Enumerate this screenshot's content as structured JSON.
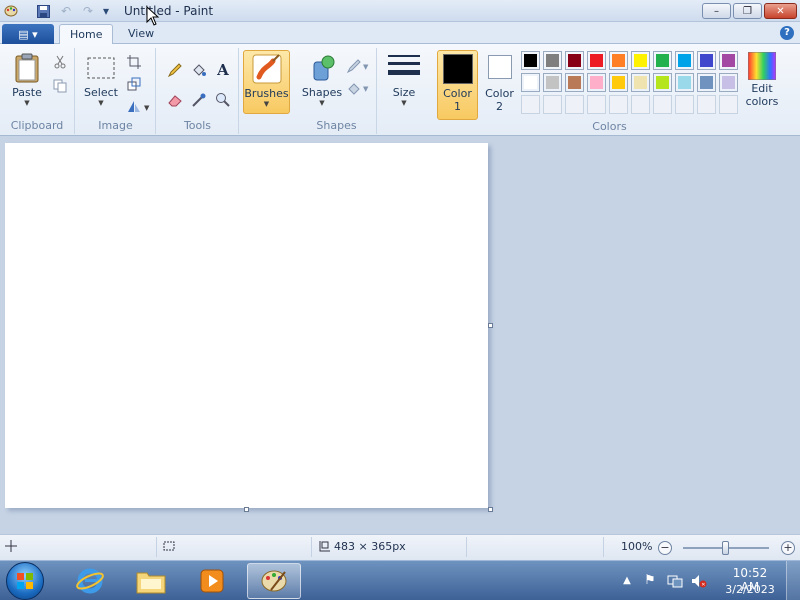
{
  "window": {
    "title": "Untitled - Paint",
    "minimize": "–",
    "maximize": "❐",
    "close": "✕"
  },
  "qat": {
    "app_icon": "paint-palette-icon",
    "save": "save-icon",
    "undo": "undo-icon",
    "redo": "redo-icon",
    "customize": "▾"
  },
  "tabs": {
    "home": "Home",
    "view": "View",
    "help": "?"
  },
  "ribbon": {
    "clipboard": {
      "label": "Clipboard",
      "paste": "Paste"
    },
    "image": {
      "label": "Image",
      "select": "Select"
    },
    "tools": {
      "label": "Tools"
    },
    "brushes": {
      "label": "Brushes"
    },
    "shapes": {
      "label": "Shapes",
      "shapes_btn": "Shapes"
    },
    "size": {
      "label": "Size"
    },
    "colors": {
      "label": "Colors",
      "color1": "Color",
      "color1_num": "1",
      "color2": "Color",
      "color2_num": "2",
      "edit1": "Edit",
      "edit2": "colors",
      "color1_value": "#000000",
      "color2_value": "#ffffff",
      "row1": [
        "#000000",
        "#7f7f7f",
        "#880015",
        "#ed1c24",
        "#ff7f27",
        "#fff200",
        "#22b14c",
        "#00a2e8",
        "#3f48cc",
        "#a349a4"
      ],
      "row2": [
        "#ffffff",
        "#c3c3c3",
        "#b97a57",
        "#ffaec9",
        "#ffc90e",
        "#efe4b0",
        "#b5e61d",
        "#99d9ea",
        "#7092be",
        "#c8bfe7"
      ]
    }
  },
  "status": {
    "canvas_size": "483 × 365px",
    "zoom": "100%",
    "zoom_level": 0.5
  },
  "taskbar": {
    "time": "10:52 AM",
    "date": "3/2/2023"
  }
}
